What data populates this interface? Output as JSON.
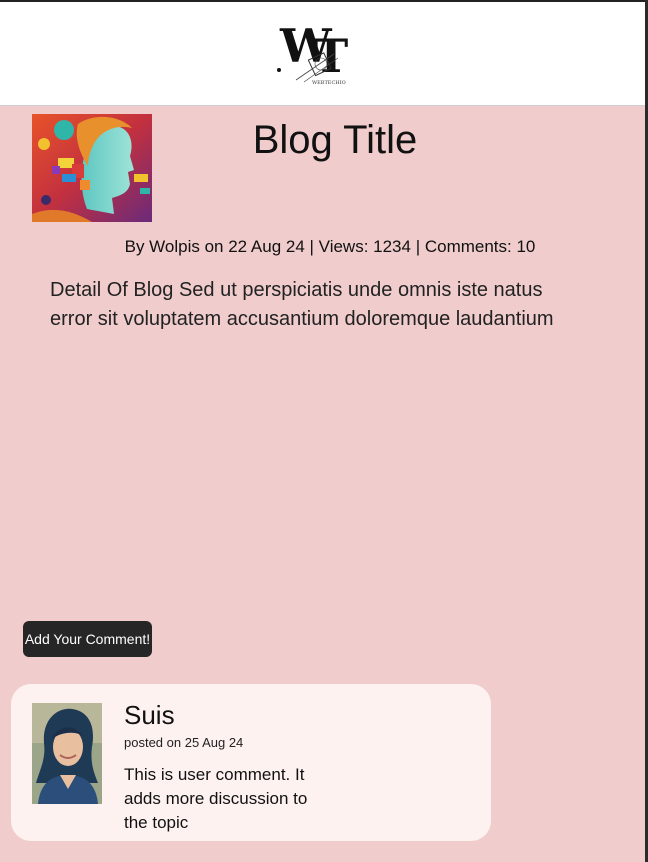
{
  "header": {
    "logo_text": "WT",
    "logo_subtext": "WEBTECHIO"
  },
  "post": {
    "title": "Blog Title",
    "meta": "By Wolpis on 22 Aug 24 | Views: 1234 | Comments: 10",
    "detail": "Detail Of Blog Sed ut perspiciatis unde omnis iste natus error sit voluptatem accusantium doloremque laudantium"
  },
  "actions": {
    "add_comment_label": "Add Your Comment!"
  },
  "comment": {
    "author": "Suis",
    "posted": "posted on 25 Aug 24",
    "text": "This is user comment. It adds more discussion to the topic"
  }
}
